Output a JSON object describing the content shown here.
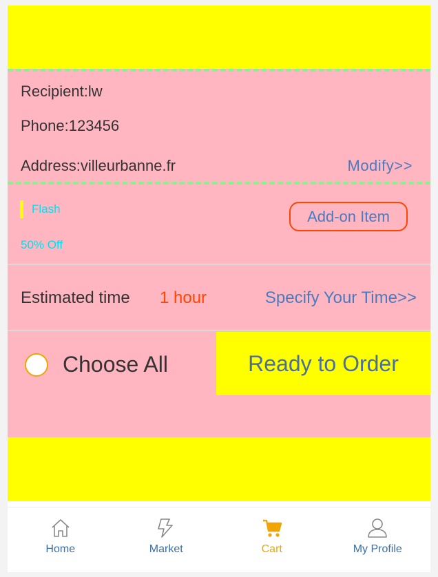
{
  "address": {
    "recipient": "Recipient:lw",
    "phone": "Phone:123456",
    "address": "Address:villeurbanne.fr",
    "modify_label": "Modify>>"
  },
  "promo": {
    "flash_label": "Flash",
    "discount_label": "50% Off",
    "addon_label": "Add-on Item"
  },
  "time": {
    "label": "Estimated time",
    "value": "1 hour",
    "specify_label": "Specify Your Time>>"
  },
  "order": {
    "choose_all_label": "Choose All",
    "ready_label": "Ready to Order",
    "choose_all_checked": false
  },
  "tabbar": {
    "active": "cart",
    "items": [
      {
        "label": "Home",
        "icon": "home-icon"
      },
      {
        "label": "Market",
        "icon": "market-icon"
      },
      {
        "label": "Cart",
        "icon": "cart-icon"
      },
      {
        "label": "My Profile",
        "icon": "profile-icon"
      }
    ]
  },
  "colors": {
    "banner": "#ffff00",
    "panel": "#ffb6c1",
    "dashed_border": "#90ee90",
    "link": "#4a7bbf",
    "accent_orange": "#ff4500",
    "cyan_text": "#00e0f0",
    "active_tab": "#f0a500"
  }
}
